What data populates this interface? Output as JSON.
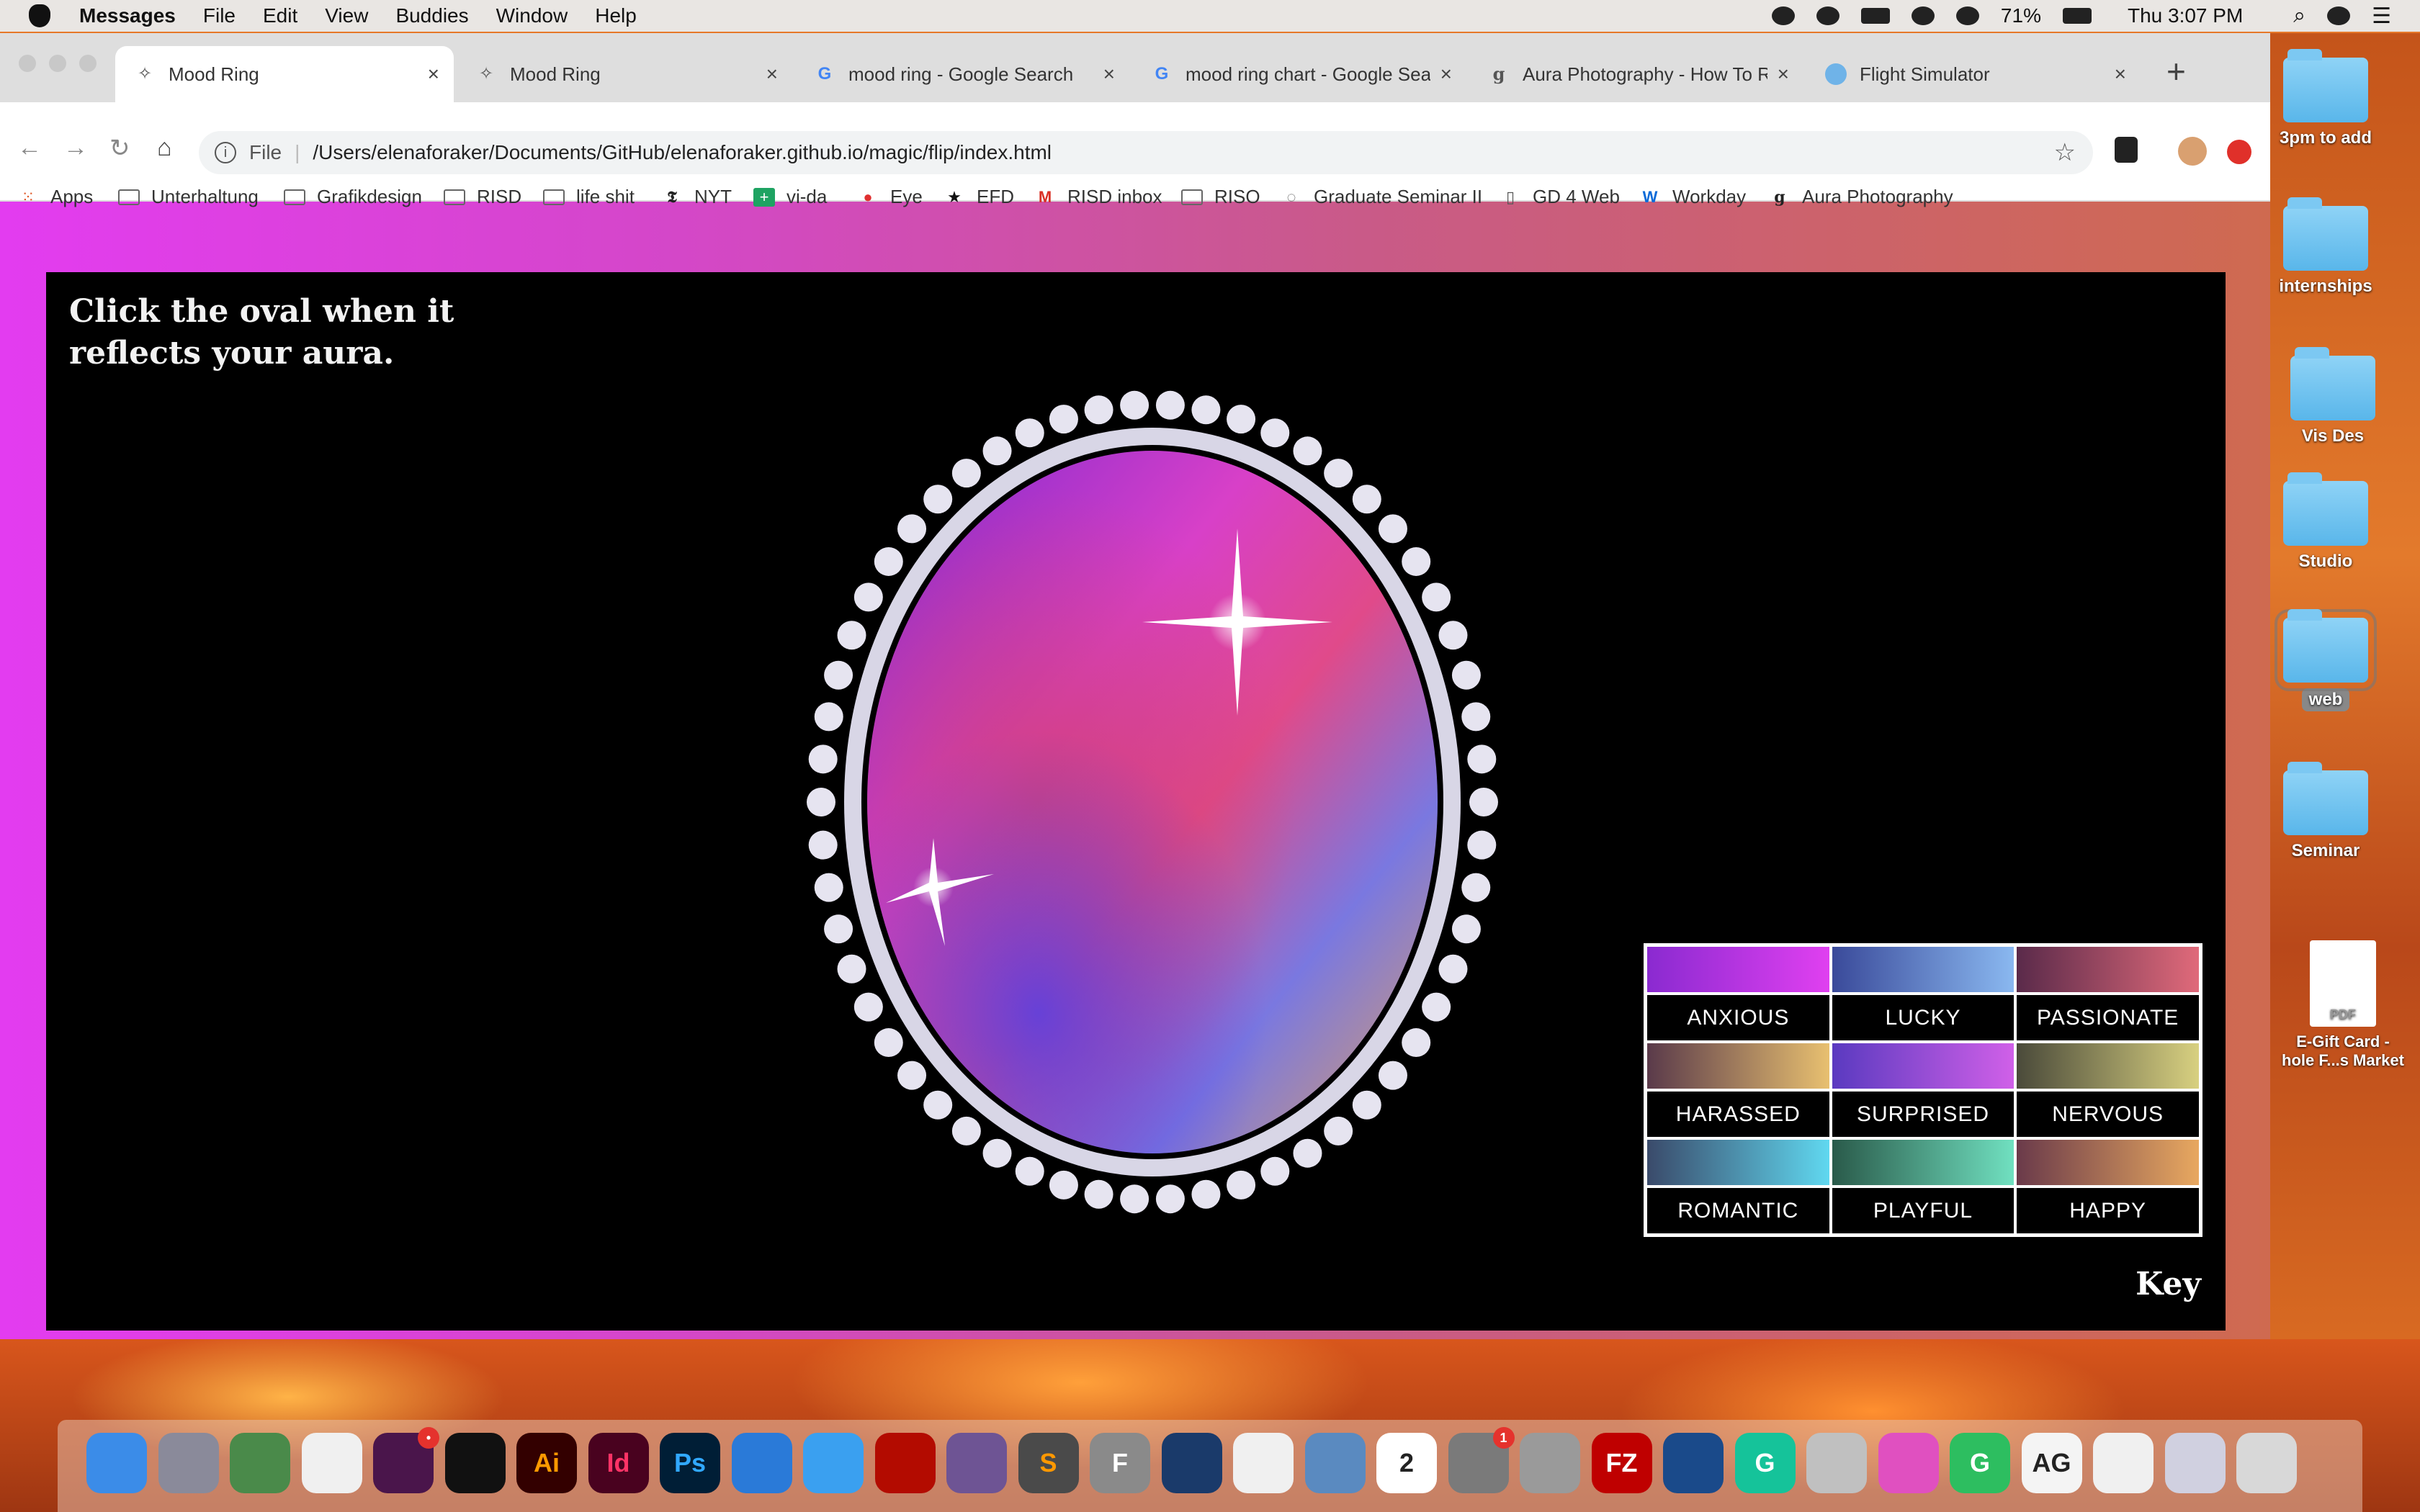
{
  "menubar": {
    "app": "Messages",
    "items": [
      "File",
      "Edit",
      "View",
      "Buddies",
      "Window",
      "Help"
    ],
    "battery": "71%",
    "clock": "Thu 3:07 PM"
  },
  "tabs": [
    {
      "label": "Mood Ring",
      "icon": "sparkle-icon",
      "active": true
    },
    {
      "label": "Mood Ring",
      "icon": "sparkle-icon",
      "active": false
    },
    {
      "label": "mood ring - Google Search",
      "icon": "google-icon",
      "active": false
    },
    {
      "label": "mood ring chart - Google Sea",
      "icon": "google-icon",
      "active": false
    },
    {
      "label": "Aura Photography - How To R",
      "icon": "aura-icon",
      "active": false
    },
    {
      "label": "Flight Simulator",
      "icon": "globe-icon",
      "active": false
    }
  ],
  "address": {
    "scheme": "File",
    "url": "/Users/elenaforaker/Documents/GitHub/elenaforaker.github.io/magic/flip/index.html"
  },
  "bookmarks": [
    {
      "label": "Apps",
      "icon": "apps-grid-icon"
    },
    {
      "label": "Unterhaltung",
      "icon": "folder-icon"
    },
    {
      "label": "Grafikdesign",
      "icon": "folder-icon"
    },
    {
      "label": "RISD",
      "icon": "folder-icon"
    },
    {
      "label": "life shit",
      "icon": "folder-icon"
    },
    {
      "label": "NYT",
      "icon": "nyt-icon"
    },
    {
      "label": "vi-da",
      "icon": "sheet-icon"
    },
    {
      "label": "Eye",
      "icon": "eye-icon"
    },
    {
      "label": "EFD",
      "icon": "star-icon"
    },
    {
      "label": "RISD inbox",
      "icon": "gmail-icon"
    },
    {
      "label": "RISO",
      "icon": "folder-icon"
    },
    {
      "label": "Graduate Seminar II",
      "icon": "chat-icon"
    },
    {
      "label": "GD 4 Web",
      "icon": "doc-icon"
    },
    {
      "label": "Workday",
      "icon": "workday-icon"
    },
    {
      "label": "Aura Photography",
      "icon": "aura-icon"
    }
  ],
  "page": {
    "instruction": "Click the oval when it reflects your aura.",
    "key_title": "Key",
    "key": [
      {
        "label": "ANXIOUS",
        "from": "#8a2ad0",
        "to": "#e040f0"
      },
      {
        "label": "LUCKY",
        "from": "#3a4a9a",
        "to": "#8ab8f0"
      },
      {
        "label": "PASSIONATE",
        "from": "#5a2a4a",
        "to": "#e06a7a"
      },
      {
        "label": "HARASSED",
        "from": "#5a3a4a",
        "to": "#e8c070"
      },
      {
        "label": "SURPRISED",
        "from": "#5a3ac0",
        "to": "#d060e8"
      },
      {
        "label": "NERVOUS",
        "from": "#4a4a3a",
        "to": "#d8d080"
      },
      {
        "label": "ROMANTIC",
        "from": "#3a4a6a",
        "to": "#60d8f0"
      },
      {
        "label": "PLAYFUL",
        "from": "#2a5a4a",
        "to": "#70e0c0"
      },
      {
        "label": "HAPPY",
        "from": "#6a3a4a",
        "to": "#e8a860"
      }
    ],
    "mirror_colors": {
      "frame": "#d8d6e6",
      "gem_a": "#8a2ad0",
      "gem_b": "#e040c0",
      "gem_c": "#6a70e0",
      "gem_d": "#e09060"
    }
  },
  "desktop": [
    {
      "label": "3pm to add",
      "type": "folder"
    },
    {
      "label": "internships",
      "type": "folder"
    },
    {
      "label": "Vis Des",
      "type": "folder"
    },
    {
      "label": "Studio",
      "type": "folder"
    },
    {
      "label": "web",
      "type": "folder",
      "selected": true
    },
    {
      "label": "Seminar",
      "type": "folder"
    },
    {
      "label": "E-Gift Card -\nhole F...s Market",
      "type": "pdf",
      "pdf_tag": "PDF"
    }
  ],
  "dock": [
    {
      "name": "finder-icon",
      "bg": "#3b8ce8",
      "text": ""
    },
    {
      "name": "launchpad-icon",
      "bg": "#8a8a9a",
      "text": ""
    },
    {
      "name": "chrome-icon",
      "bg": "#4a8a4a",
      "text": ""
    },
    {
      "name": "textedit-icon",
      "bg": "#f0f0f0",
      "text": ""
    },
    {
      "name": "slack-icon",
      "bg": "#4a154b",
      "text": "",
      "badge": "•"
    },
    {
      "name": "tidal-icon",
      "bg": "#111",
      "text": ""
    },
    {
      "name": "illustrator-icon",
      "bg": "#330000",
      "text": "Ai",
      "color": "#ff9a00"
    },
    {
      "name": "indesign-icon",
      "bg": "#49021f",
      "text": "Id",
      "color": "#ff3366"
    },
    {
      "name": "photoshop-icon",
      "bg": "#001e36",
      "text": "Ps",
      "color": "#31a8ff"
    },
    {
      "name": "keynote-icon",
      "bg": "#2a7ad8",
      "text": ""
    },
    {
      "name": "messages-icon",
      "bg": "#3aa0f0",
      "text": ""
    },
    {
      "name": "acrobat-icon",
      "bg": "#b30b00",
      "text": ""
    },
    {
      "name": "github-icon",
      "bg": "#6e5494",
      "text": ""
    },
    {
      "name": "sublime-icon",
      "bg": "#4a4a4a",
      "text": "S",
      "color": "#ff9800"
    },
    {
      "name": "fontbook-icon",
      "bg": "#8a8a8a",
      "text": "F"
    },
    {
      "name": "cinema4d-icon",
      "bg": "#1a3a6a",
      "text": ""
    },
    {
      "name": "photos-icon",
      "bg": "#f0f0f0",
      "text": ""
    },
    {
      "name": "preview-icon",
      "bg": "#5a8ac0",
      "text": ""
    },
    {
      "name": "calendar-icon",
      "bg": "#fff",
      "text": "2",
      "color": "#222"
    },
    {
      "name": "system-preferences-icon",
      "bg": "#7a7a7a",
      "text": "",
      "badge": "1"
    },
    {
      "name": "calculator-icon",
      "bg": "#9a9a9a",
      "text": ""
    },
    {
      "name": "filezilla-icon",
      "bg": "#bf0000",
      "text": "FZ"
    },
    {
      "name": "quicktime-icon",
      "bg": "#1a4a8a",
      "text": ""
    },
    {
      "name": "grammarly-icon",
      "bg": "#15c39a",
      "text": "G"
    },
    {
      "name": "applications-icon",
      "bg": "#c0c0c0",
      "text": ""
    },
    {
      "name": "itunes-icon",
      "bg": "#e050c0",
      "text": ""
    },
    {
      "name": "evernote-icon",
      "bg": "#2dbe60",
      "text": "G"
    },
    {
      "name": "font-preview-icon",
      "bg": "#f4f4f4",
      "text": "AG",
      "color": "#222"
    },
    {
      "name": "document-stack-icon",
      "bg": "#f0f0f0",
      "text": ""
    },
    {
      "name": "screenshot-stack-icon",
      "bg": "#d0d0e0",
      "text": ""
    },
    {
      "name": "trash-icon",
      "bg": "#d8d8d8",
      "text": ""
    }
  ]
}
